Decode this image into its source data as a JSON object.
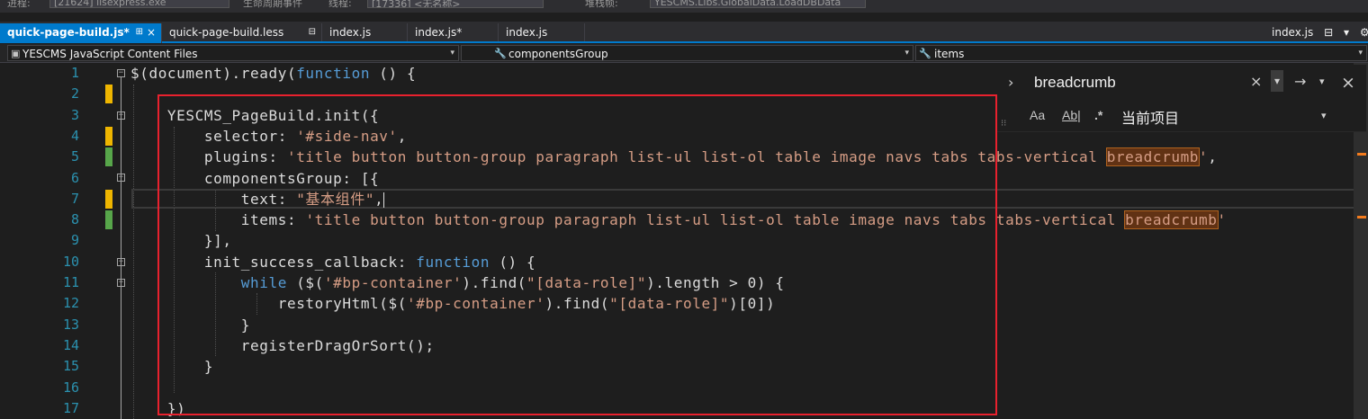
{
  "toolbar": {
    "process_label": "进程:",
    "process_value": "[21624] iisexpress.exe",
    "lifecycle_label": "生命周期事件",
    "thread_label": "线程:",
    "thread_value": "[17336] <无名称>",
    "stack_label": "堆栈帧:",
    "stack_value": "YESCMS.Libs.GlobalData.LoadDBData"
  },
  "tabs": [
    {
      "label": "quick-page-build.js*",
      "active": true,
      "pin": "⊞",
      "close": "×"
    },
    {
      "label": "quick-page-build.less",
      "pin": "⊟"
    },
    {
      "label": "index.js"
    },
    {
      "label": "index.js*"
    },
    {
      "label": "index.js"
    }
  ],
  "right_tab": {
    "label": "index.js"
  },
  "navbar": {
    "project": "YESCMS JavaScript Content Files",
    "scope": "componentsGroup",
    "member": "items"
  },
  "editor": {
    "line_numbers": [
      "1",
      "2",
      "3",
      "4",
      "5",
      "6",
      "7",
      "8",
      "9",
      "10",
      "11",
      "12",
      "13",
      "14",
      "15",
      "16",
      "17"
    ],
    "lines": [
      [
        {
          "t": "$(document).ready(",
          "c": "prop"
        },
        {
          "t": "function",
          "c": "kw"
        },
        {
          "t": " () {",
          "c": "prop"
        }
      ],
      [],
      [
        {
          "t": "    YESCMS_PageBuild.init({",
          "c": "prop"
        }
      ],
      [
        {
          "t": "        selector: ",
          "c": "prop"
        },
        {
          "t": "'#side-nav'",
          "c": "str"
        },
        {
          "t": ",",
          "c": "prop"
        }
      ],
      [
        {
          "t": "        plugins: ",
          "c": "prop"
        },
        {
          "t": "'title button button-group paragraph list-ul list-ol table image navs tabs tabs-vertical ",
          "c": "str"
        },
        {
          "t": "breadcrumb",
          "c": "hl"
        },
        {
          "t": "'",
          "c": "str"
        },
        {
          "t": ",",
          "c": "prop"
        }
      ],
      [
        {
          "t": "        componentsGroup: [{",
          "c": "prop"
        }
      ],
      [
        {
          "t": "            text: ",
          "c": "prop"
        },
        {
          "t": "\"基本组件\"",
          "c": "str"
        },
        {
          "t": ",",
          "c": "prop"
        },
        {
          "t": "",
          "c": "caret"
        }
      ],
      [
        {
          "t": "            items: ",
          "c": "prop"
        },
        {
          "t": "'title button button-group paragraph list-ul list-ol table image navs tabs tabs-vertical ",
          "c": "str"
        },
        {
          "t": "breadcrumb",
          "c": "hl"
        },
        {
          "t": "'",
          "c": "str"
        }
      ],
      [
        {
          "t": "        }],",
          "c": "prop"
        }
      ],
      [
        {
          "t": "        init_success_callback: ",
          "c": "prop"
        },
        {
          "t": "function",
          "c": "kw"
        },
        {
          "t": " () {",
          "c": "prop"
        }
      ],
      [
        {
          "t": "            ",
          "c": "prop"
        },
        {
          "t": "while",
          "c": "kw"
        },
        {
          "t": " ($(",
          "c": "prop"
        },
        {
          "t": "'#bp-container'",
          "c": "str"
        },
        {
          "t": ").find(",
          "c": "prop"
        },
        {
          "t": "\"[data-role]\"",
          "c": "str"
        },
        {
          "t": ").length > 0) {",
          "c": "prop"
        }
      ],
      [
        {
          "t": "                restoryHtml($(",
          "c": "prop"
        },
        {
          "t": "'#bp-container'",
          "c": "str"
        },
        {
          "t": ").find(",
          "c": "prop"
        },
        {
          "t": "\"[data-role]\"",
          "c": "str"
        },
        {
          "t": ")[0])",
          "c": "prop"
        }
      ],
      [
        {
          "t": "            }",
          "c": "prop"
        }
      ],
      [
        {
          "t": "            registerDragOrSort();",
          "c": "prop"
        }
      ],
      [
        {
          "t": "        }",
          "c": "prop"
        }
      ],
      [],
      [
        {
          "t": "    })",
          "c": "prop"
        }
      ]
    ]
  },
  "find_widget": {
    "term": "breadcrumb",
    "close": "×",
    "dropdown": "▾",
    "next": "→",
    "opt_case": "Aa",
    "opt_word": "Ab|",
    "opt_regex": ".*",
    "scope_label": "当前项目",
    "scope_dropdown": "▾"
  }
}
